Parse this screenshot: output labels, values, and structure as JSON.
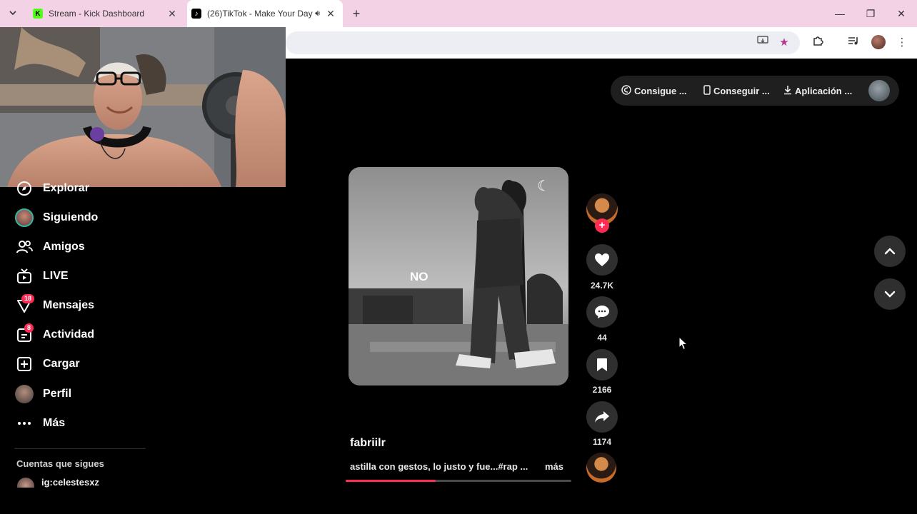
{
  "browser": {
    "tabs": [
      {
        "title": "Stream - Kick Dashboard",
        "favicon": "K"
      },
      {
        "title": "(26)TikTok - Make Your Day",
        "favicon": "♪"
      }
    ]
  },
  "header_actions": [
    {
      "label": "Consigue ...",
      "icon": "coin-icon"
    },
    {
      "label": "Conseguir ...",
      "icon": "phone-icon"
    },
    {
      "label": "Aplicación ...",
      "icon": "download-icon"
    }
  ],
  "sidebar": {
    "items": [
      {
        "label": "Explorar",
        "icon": "compass-icon"
      },
      {
        "label": "Siguiendo",
        "icon": "following-avatar"
      },
      {
        "label": "Amigos",
        "icon": "friends-icon"
      },
      {
        "label": "LIVE",
        "icon": "live-tv-icon"
      },
      {
        "label": "Mensajes",
        "icon": "message-icon",
        "badge": "18"
      },
      {
        "label": "Actividad",
        "icon": "activity-icon",
        "badge": "8"
      },
      {
        "label": "Cargar",
        "icon": "upload-icon"
      },
      {
        "label": "Perfil",
        "icon": "profile-avatar"
      },
      {
        "label": "Más",
        "icon": "more-dots-icon"
      }
    ],
    "following_heading": "Cuentas que sigues",
    "following_accounts": [
      "ig:celestesxz"
    ]
  },
  "video": {
    "overlay_text": "NO",
    "author": "fabriilr",
    "caption": "astilla con gestos, lo justo y fue...#rap ...",
    "more_label": "más",
    "progress": 0.4
  },
  "actions": {
    "likes": "24.7K",
    "comments": "44",
    "saves": "2166",
    "shares": "1174"
  },
  "colors": {
    "accent": "#fe2c55",
    "tabbar": "#f3d2e6",
    "background": "#000000"
  }
}
